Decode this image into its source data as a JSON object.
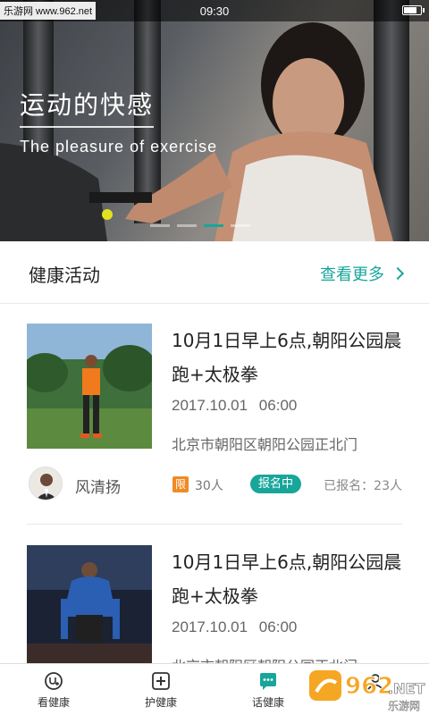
{
  "status_bar": {
    "watermark": "乐游网 www.962.net",
    "time": "09:30"
  },
  "banner": {
    "title": "运动的快感",
    "subtitle": "The pleasure of exercise",
    "dots_count": 4,
    "active_dot": 2,
    "accent": "#19a69a"
  },
  "section": {
    "title": "健康活动",
    "see_more": "查看更多"
  },
  "activities": [
    {
      "title": "10月1日早上6点,朝阳公园晨跑+太极拳",
      "date": "2017.10.01 06:00",
      "address": "北京市朝阳区朝阳公园正北门",
      "organizer": "风清扬",
      "limit_badge": "限",
      "limit": "30人",
      "status": "报名中",
      "signed": "已报名：23人"
    },
    {
      "title": "10月1日早上6点,朝阳公园晨跑+太极拳",
      "date": "2017.10.01 06:00",
      "address": "北京市朝阳区朝阳公园正北门"
    }
  ],
  "bottom_nav": [
    {
      "label": "看健康",
      "icon": "stethoscope-icon"
    },
    {
      "label": "护健康",
      "icon": "medical-plus-icon"
    },
    {
      "label": "话健康",
      "icon": "chat-bubble-icon",
      "active": true
    },
    {
      "label": "",
      "icon": "profile-icon"
    }
  ],
  "watermark_corner": {
    "brand": "962",
    "domain": ".NET",
    "site": "乐游网"
  },
  "colors": {
    "accent": "#19a69a",
    "limit": "#f08a24"
  }
}
